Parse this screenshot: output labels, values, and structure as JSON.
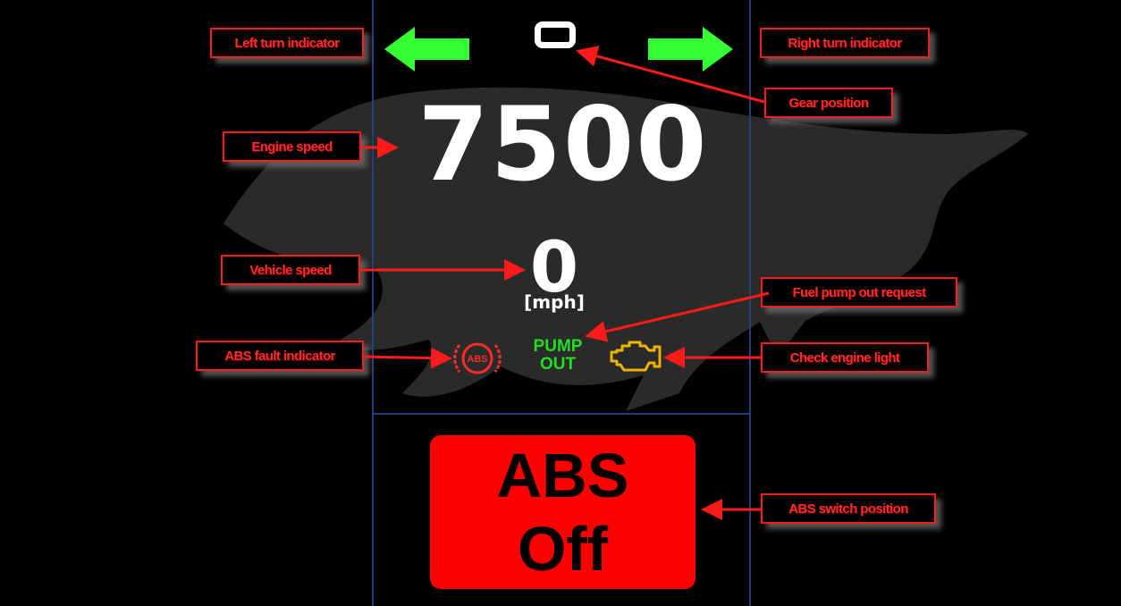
{
  "dashboard": {
    "gear_position": "0",
    "engine_speed": "7500",
    "vehicle_speed": "0",
    "speed_unit": "[mph]",
    "abs_light_label": "ABS",
    "pump_out_line1": "PUMP",
    "pump_out_line2": "OUT",
    "abs_switch_line1": "ABS",
    "abs_switch_line2": "Off"
  },
  "callouts": {
    "left_turn": "Left turn indicator",
    "right_turn": "Right turn indicator",
    "gear": "Gear position",
    "engine_speed": "Engine speed",
    "vehicle_speed": "Vehicle speed",
    "fuel_pump": "Fuel pump out request",
    "abs_fault": "ABS fault indicator",
    "check_engine": "Check engine light",
    "abs_switch": "ABS switch position"
  },
  "colors": {
    "background": "#000000",
    "divider": "#1f3f7a",
    "turn_arrow": "#33ff33",
    "callout": "#ff1a1a",
    "abs_fault": "#ff2a2a",
    "pump_out": "#22dd22",
    "check_engine": "#f0b400",
    "abs_switch_bg": "#ff0000"
  },
  "icons": {
    "left_turn": "left-arrow-icon",
    "right_turn": "right-arrow-icon",
    "abs_fault": "abs-warning-icon",
    "check_engine": "engine-icon",
    "logo": "mustang-pony-logo"
  }
}
